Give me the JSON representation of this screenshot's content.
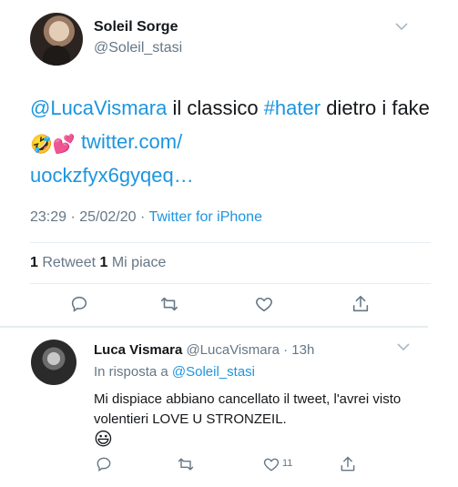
{
  "tweet": {
    "author_name": "Soleil Sorge",
    "author_handle": "@Soleil_stasi",
    "mention": "@LucaVismara",
    "text_part1": " il classico ",
    "hashtag": "#hater",
    "text_part2": " dietro i fake ",
    "emojis": "🤣💕",
    "link_line1": "twitter.com/",
    "link_line2": "uockzfyx6gyqeq…",
    "timestamp": "23:29 · 25/02/20 · ",
    "source": "Twitter for iPhone",
    "retweets_count": "1",
    "retweets_label": " Retweet ",
    "likes_count": "1",
    "likes_label": " Mi piace",
    "icons": [
      "reply-icon",
      "retweet-icon",
      "like-icon",
      "share-icon"
    ]
  },
  "reply": {
    "author_name": "Luca Vismara",
    "author_handle": " @LucaVismara · 13h",
    "in_reply_prefix": "In risposta a ",
    "in_reply_handle": "@Soleil_stasi",
    "text": "Mi dispiace abbiano cancellato il tweet, l'avrei visto volentieri LOVE U STRONZEIL.",
    "emoji": "😃",
    "like_count": "11"
  },
  "colors": {
    "link": "#1b95e0",
    "secondary_text": "#657786",
    "divider": "#e6ecf0"
  }
}
